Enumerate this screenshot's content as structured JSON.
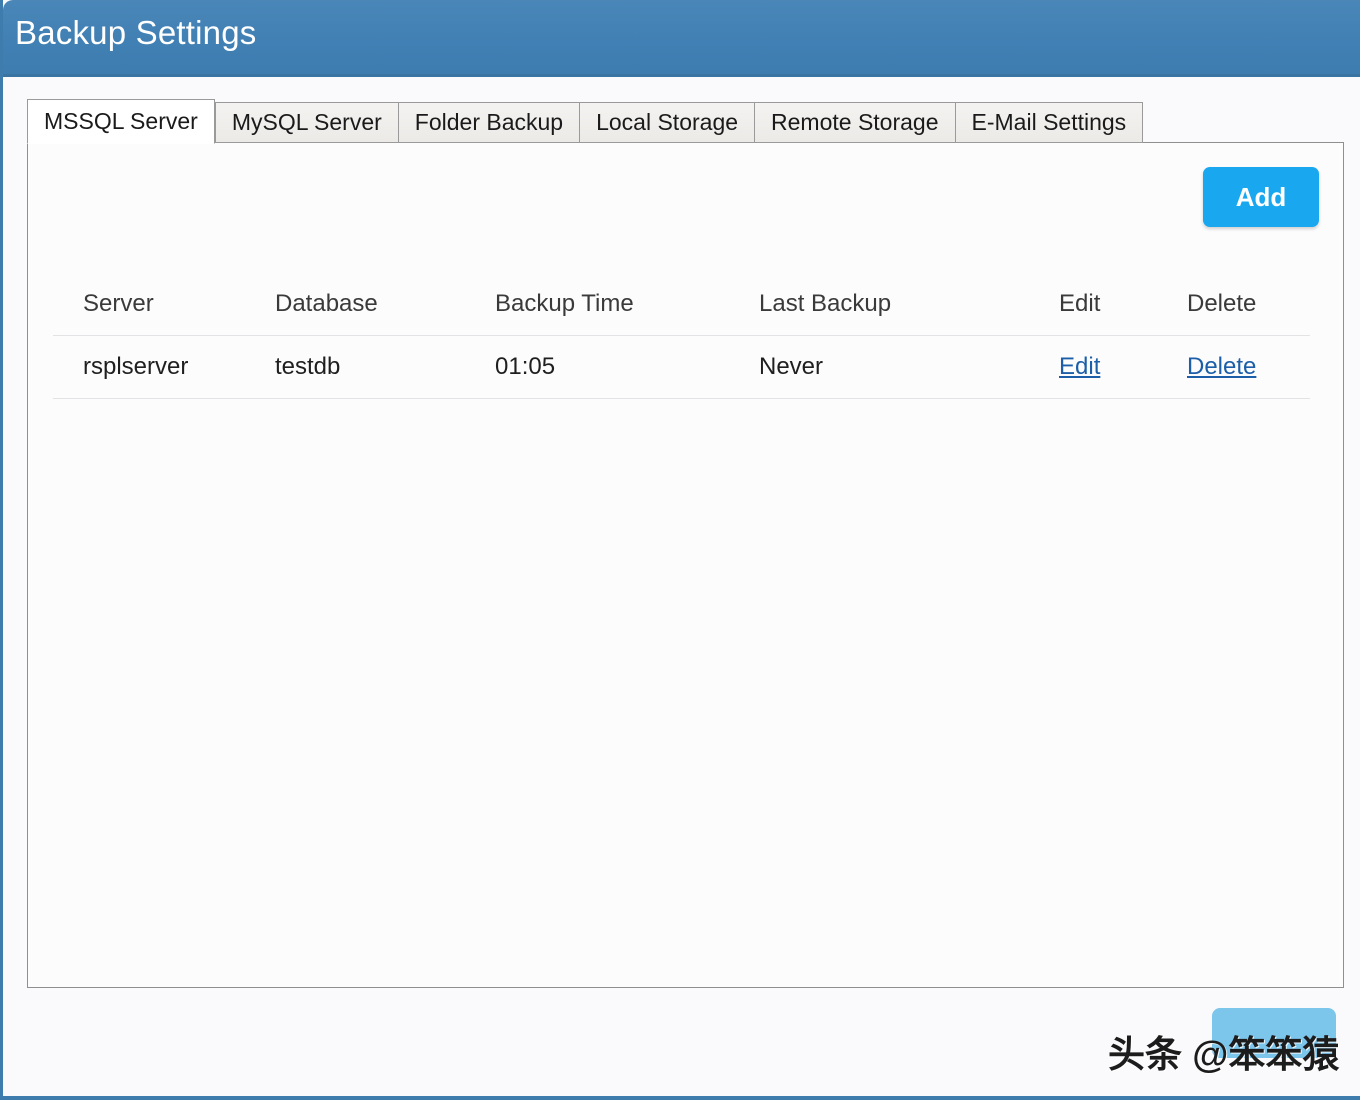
{
  "window": {
    "title": "Backup Settings",
    "title_bar_color": "#4180b4",
    "accent_color": "#19a8ef",
    "link_color": "#1c5fa8"
  },
  "tabs": [
    {
      "label": "MSSQL Server",
      "active": true
    },
    {
      "label": "MySQL Server",
      "active": false
    },
    {
      "label": "Folder Backup",
      "active": false
    },
    {
      "label": "Local Storage",
      "active": false
    },
    {
      "label": "Remote Storage",
      "active": false
    },
    {
      "label": "E-Mail Settings",
      "active": false
    }
  ],
  "toolbar": {
    "add_label": "Add"
  },
  "table": {
    "columns": [
      "Server",
      "Database",
      "Backup Time",
      "Last Backup",
      "Edit",
      "Delete"
    ],
    "rows": [
      {
        "server": "rsplserver",
        "database": "testdb",
        "backup_time": "01:05",
        "last_backup": "Never",
        "edit_label": "Edit",
        "delete_label": "Delete"
      }
    ]
  },
  "footer": {
    "button_label": ""
  },
  "watermark": {
    "text": "头条 @笨笨猿"
  }
}
